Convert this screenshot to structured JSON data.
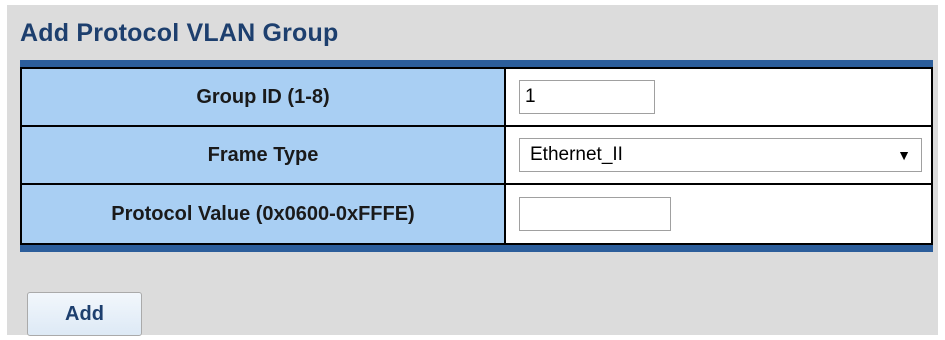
{
  "title": "Add Protocol VLAN Group",
  "fields": {
    "group_id": {
      "label": "Group ID (1-8)",
      "value": "1"
    },
    "frame_type": {
      "label": "Frame Type",
      "selected": "Ethernet_II"
    },
    "protocol_value": {
      "label": "Protocol Value (0x0600-0xFFFE)",
      "value": ""
    }
  },
  "add_button_label": "Add",
  "icons": {
    "dropdown": "dropdown-arrow-icon"
  },
  "colors": {
    "label_background": "#a9cff3",
    "header_bar": "#2c5e9b",
    "title_text": "#1d3f6e"
  }
}
